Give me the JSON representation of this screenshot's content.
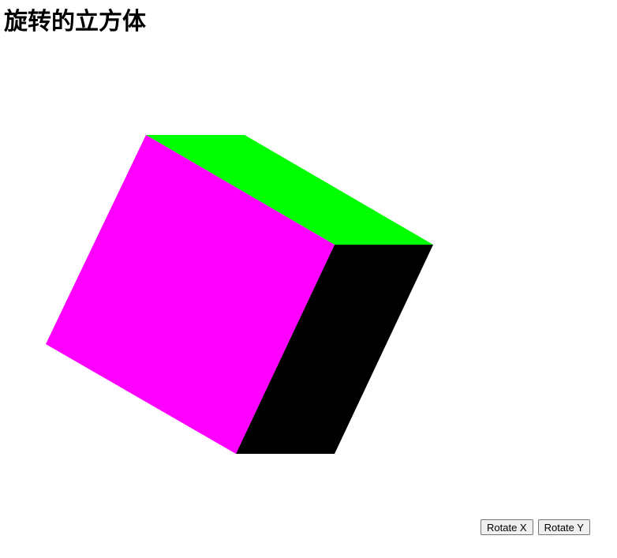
{
  "page": {
    "title": "旋转的立方体"
  },
  "cube": {
    "faces": [
      {
        "name": "top-face",
        "color": "#00ff00"
      },
      {
        "name": "front-face",
        "color": "#ff00ff"
      },
      {
        "name": "side-face",
        "color": "#000000"
      }
    ]
  },
  "controls": {
    "rotate_x_label": "Rotate X",
    "rotate_y_label": "Rotate Y"
  }
}
